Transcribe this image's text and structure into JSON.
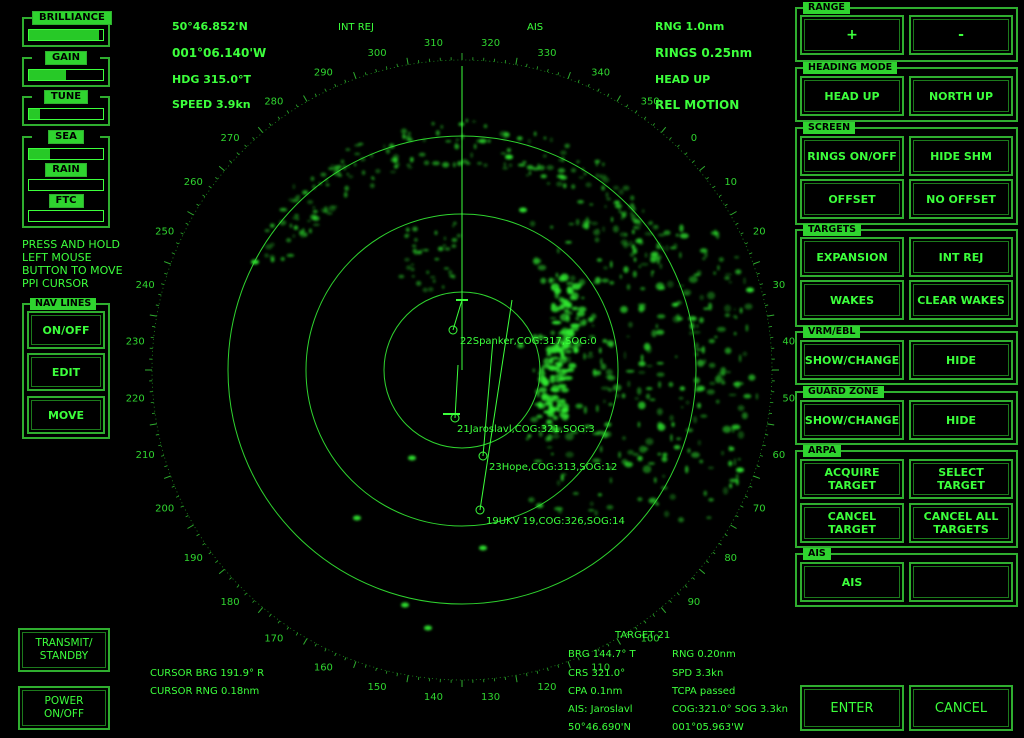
{
  "left_controls": {
    "brilliance": {
      "label": "BRILLIANCE",
      "level": 0.95
    },
    "gain": {
      "label": "GAIN",
      "level": 0.5
    },
    "tune": {
      "label": "TUNE",
      "level": 0.15
    },
    "sea": {
      "label": "SEA",
      "level": 0.28
    },
    "rain": {
      "label": "RAIN",
      "level": 0.0
    },
    "ftc": {
      "label": "FTC",
      "level": 0.0
    },
    "hint": "PRESS AND HOLD LEFT MOUSE BUTTON TO MOVE PPI CURSOR",
    "hint_lines": [
      "PRESS AND HOLD",
      "LEFT MOUSE",
      "BUTTON TO MOVE",
      "PPI CURSOR"
    ],
    "nav_lines": {
      "label": "NAV LINES",
      "on_off": "ON/OFF",
      "edit": "EDIT",
      "move": "MOVE"
    },
    "transmit": [
      "TRANSMIT/",
      "STANDBY"
    ],
    "power": [
      "POWER",
      "ON/OFF"
    ]
  },
  "header": {
    "lat": "50°46.852'N",
    "lon": "001°06.140'W",
    "hdg": "HDG 315.0°T",
    "speed": "SPEED  3.9kn",
    "int_rej": "INT REJ",
    "ais": "AIS",
    "rng": "RNG 1.0nm",
    "rings": "RINGS 0.25nm",
    "head_up": "HEAD UP",
    "rel_motion": "REL MOTION"
  },
  "ppi": {
    "bearing_labels": [
      "310",
      "320",
      "330",
      "340",
      "350",
      "0",
      "10",
      "20",
      "30",
      "40",
      "50",
      "60",
      "70",
      "80",
      "90",
      "100",
      "110",
      "120",
      "130",
      "140",
      "150",
      "160",
      "170",
      "180",
      "190",
      "200",
      "210",
      "220",
      "230",
      "240",
      "250",
      "260",
      "270",
      "280",
      "290",
      "300"
    ],
    "ais_targets": [
      "22Spanker,COG:317,SOG:0",
      "21Jaroslavl,COG:321,SOG:3",
      "23Hope,COG:313,SOG:12",
      "19UKV 19,COG:326,SOG:14"
    ]
  },
  "cursor": {
    "brg": "CURSOR BRG 191.9° R",
    "rng": "CURSOR RNG  0.18nm"
  },
  "target_info": {
    "title": "TARGET 21",
    "brg": "BRG 144.7° T",
    "rng": "RNG  0.20nm",
    "crs": "CRS 321.0°",
    "spd": "SPD   3.3kn",
    "cpa": "CPA   0.1nm",
    "tcpa": "TCPA passed",
    "ais": "AIS: Jaroslavl",
    "cogsog": "COG:321.0° SOG   3.3kn",
    "lat": "50°46.690'N",
    "lon": "001°05.963'W"
  },
  "right_panel": {
    "range": {
      "label": "RANGE",
      "plus": "+",
      "minus": "-"
    },
    "heading_mode": {
      "label": "HEADING MODE",
      "head_up": "HEAD UP",
      "north_up": "NORTH UP"
    },
    "screen": {
      "label": "SCREEN",
      "rings": "RINGS ON/OFF",
      "hide_shm": "HIDE SHM",
      "offset": "OFFSET",
      "no_offset": "NO OFFSET"
    },
    "targets": {
      "label": "TARGETS",
      "expansion": "EXPANSION",
      "int_rej": "INT REJ",
      "wakes": "WAKES",
      "clear_wakes": "CLEAR WAKES"
    },
    "vrm": {
      "label": "VRM/EBL",
      "show": "SHOW/CHANGE",
      "hide": "HIDE"
    },
    "guard": {
      "label": "GUARD ZONE",
      "show": "SHOW/CHANGE",
      "hide": "HIDE"
    },
    "arpa": {
      "label": "ARPA",
      "acquire": [
        "ACQUIRE",
        "TARGET"
      ],
      "select": [
        "SELECT",
        "TARGET"
      ],
      "cancel": [
        "CANCEL",
        "TARGET"
      ],
      "cancel_all": [
        "CANCEL ALL",
        "TARGETS"
      ]
    },
    "ais": {
      "label": "AIS",
      "ais": "AIS"
    },
    "enter": "ENTER",
    "cancel": "CANCEL"
  },
  "colors": {
    "accent": "#3cff3c",
    "border": "#2fae2f",
    "background": "#000000"
  }
}
